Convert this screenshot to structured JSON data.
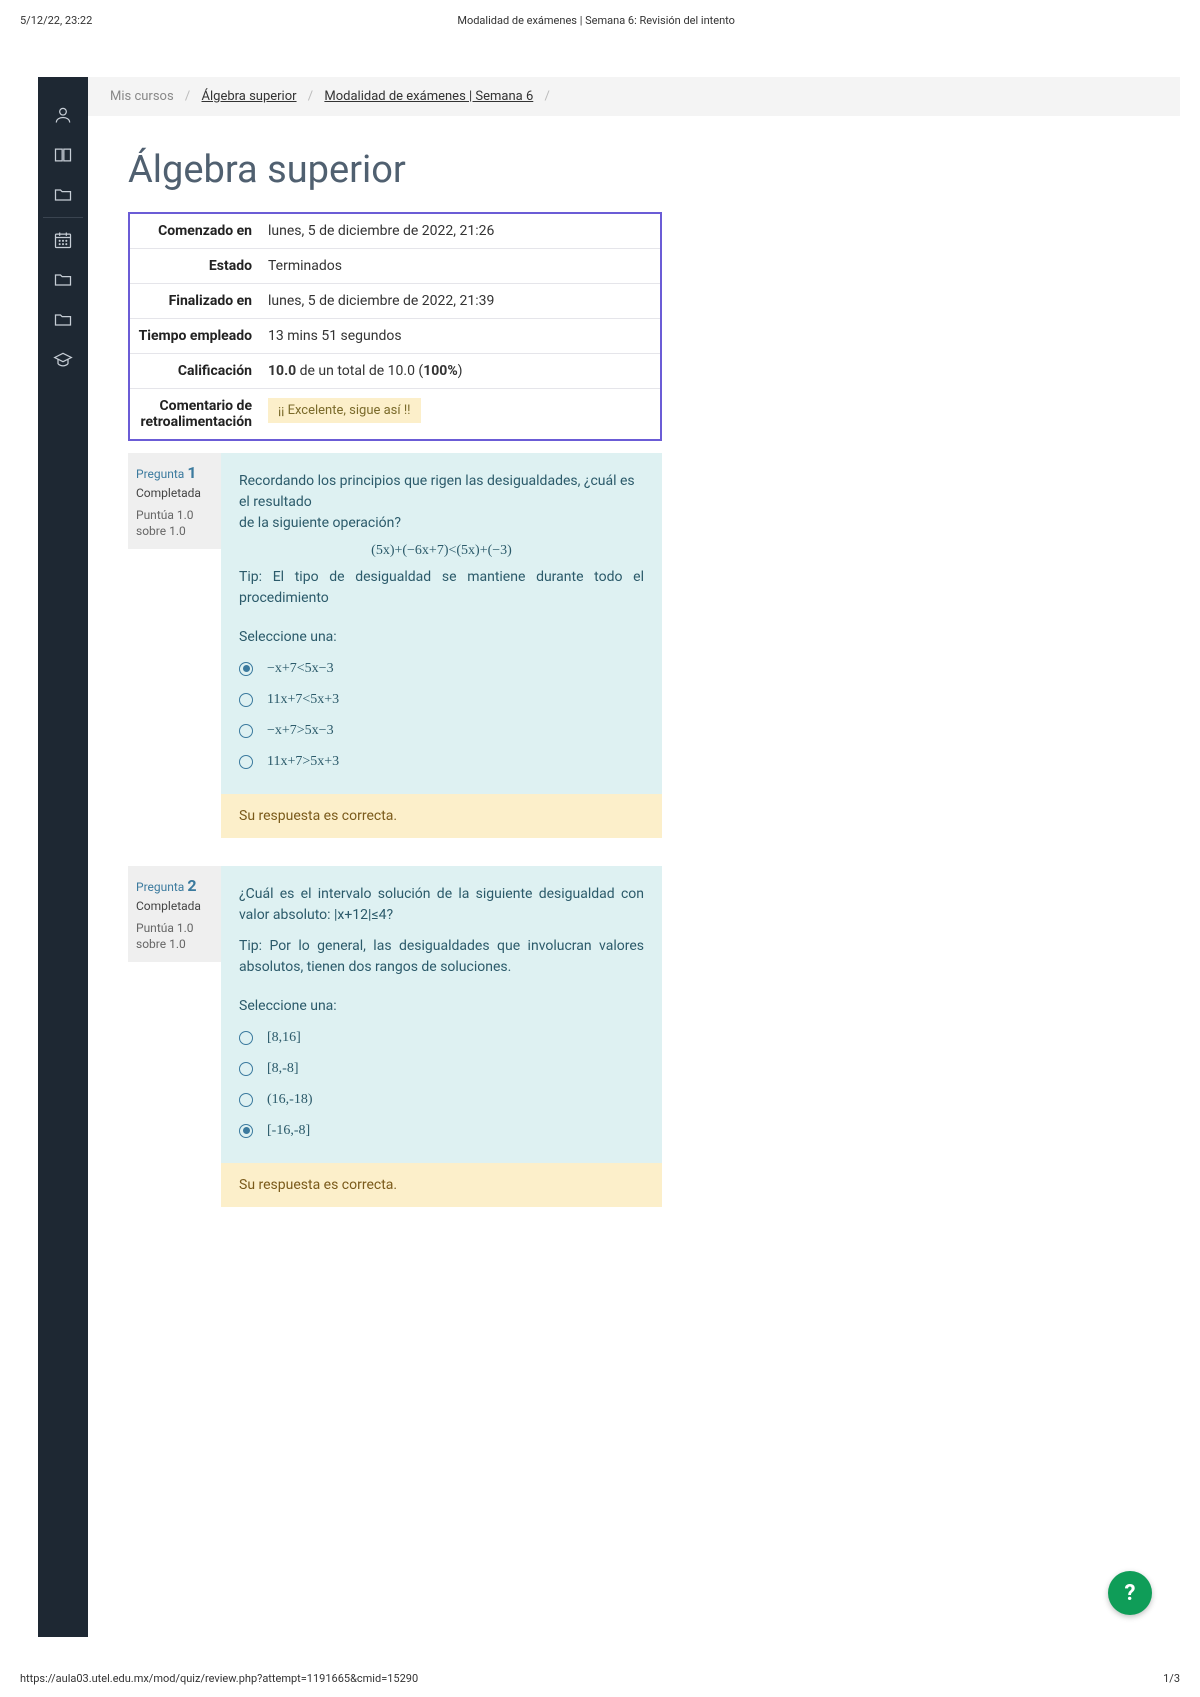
{
  "print": {
    "date": "5/12/22, 23:22",
    "title": "Modalidad de exámenes | Semana 6: Revisión del intento",
    "url": "https://aula03.utel.edu.mx/mod/quiz/review.php?attempt=1191665&cmid=15290",
    "page": "1/3"
  },
  "breadcrumb": {
    "root": "Mis cursos",
    "course": "Álgebra superior",
    "activity": "Modalidad de exámenes | Semana 6"
  },
  "page_title": "Álgebra superior",
  "summary": {
    "started_label": "Comenzado en",
    "started_value": "lunes, 5 de diciembre de 2022, 21:26",
    "state_label": "Estado",
    "state_value": "Terminados",
    "finished_label": "Finalizado en",
    "finished_value": "lunes, 5 de diciembre de 2022, 21:39",
    "time_label": "Tiempo empleado",
    "time_value": "13 mins 51 segundos",
    "grade_label": "Calificación",
    "grade_score": "10.0",
    "grade_middle": " de un total de 10.0 (",
    "grade_percent": "100%",
    "grade_close": ")",
    "feedback_label": "Comentario de retroalimentación",
    "feedback_value": "¡¡ Excelente, sigue así !!"
  },
  "q1": {
    "label": "Pregunta ",
    "number": "1",
    "status": "Completada",
    "grade": "Puntúa 1.0 sobre 1.0",
    "text1": "Recordando los principios que rigen las desigualdades, ¿cuál es el resultado",
    "text2": "de la siguiente operación?",
    "equation": "(5x)+(−6x+7)<(5x)+(−3)",
    "tip": "Tip: El tipo de desigualdad se mantiene durante todo el procedimiento",
    "prompt": "Seleccione una:",
    "options": [
      {
        "text": "−x+7<5x−3",
        "checked": true
      },
      {
        "text": "11x+7<5x+3",
        "checked": false
      },
      {
        "text": "−x+7>5x−3",
        "checked": false
      },
      {
        "text": "11x+7>5x+3",
        "checked": false
      }
    ],
    "feedback": "Su respuesta es correcta."
  },
  "q2": {
    "label": "Pregunta ",
    "number": "2",
    "status": "Completada",
    "grade": "Puntúa 1.0 sobre 1.0",
    "text1": "¿Cuál es el intervalo solución de la siguiente desigualdad con valor absoluto: |x+12|≤4?",
    "tip": "Tip: Por lo general, las desigualdades que involucran valores absolutos, tienen dos rangos de soluciones.",
    "prompt": "Seleccione una:",
    "options": [
      {
        "text": "[8,16]",
        "checked": false
      },
      {
        "text": "[8,-8]",
        "checked": false
      },
      {
        "text": "(16,-18)",
        "checked": false
      },
      {
        "text": "[-16,-8]",
        "checked": true
      }
    ],
    "feedback": "Su respuesta es correcta."
  },
  "help_label": "?"
}
